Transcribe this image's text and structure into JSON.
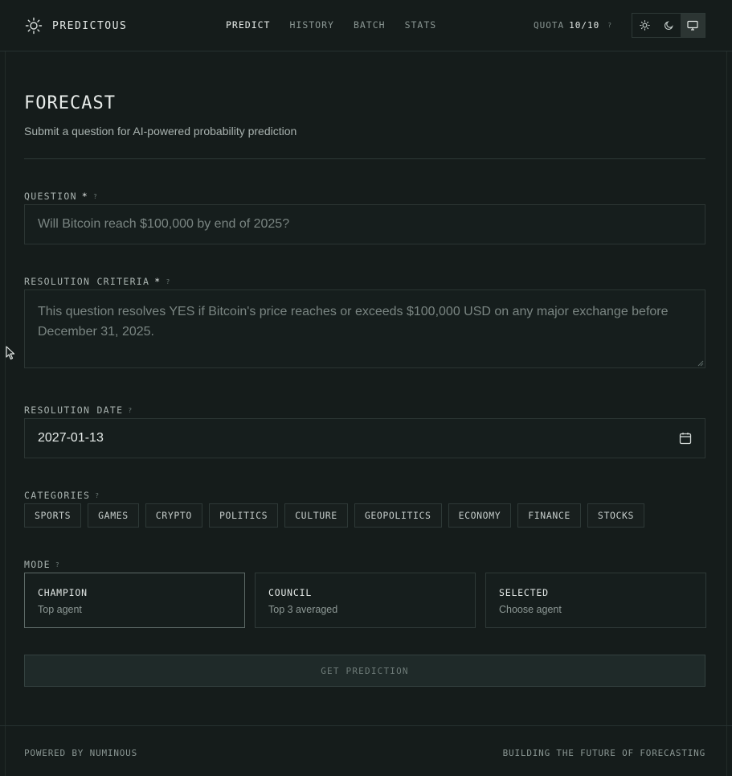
{
  "header": {
    "brand": "PREDICTOUS",
    "brand_icon": "sun-logo-icon",
    "nav": [
      {
        "label": "PREDICT",
        "active": true
      },
      {
        "label": "HISTORY",
        "active": false
      },
      {
        "label": "BATCH",
        "active": false
      },
      {
        "label": "STATS",
        "active": false
      }
    ],
    "quota_label": "QUOTA",
    "quota_value": "10/10",
    "quota_help": "?",
    "theme_options": [
      "sun-icon",
      "moon-icon",
      "monitor-icon"
    ],
    "theme_selected": "monitor-icon"
  },
  "page": {
    "title": "FORECAST",
    "subtitle": "Submit a question for AI-powered probability prediction"
  },
  "form": {
    "question": {
      "label": "QUESTION",
      "required": "*",
      "help": "?",
      "placeholder": "Will Bitcoin reach $100,000 by end of 2025?"
    },
    "criteria": {
      "label": "RESOLUTION CRITERIA",
      "required": "*",
      "help": "?",
      "placeholder": "This question resolves YES if Bitcoin's price reaches or exceeds $100,000 USD on any major exchange before December 31, 2025."
    },
    "date": {
      "label": "RESOLUTION DATE",
      "help": "?",
      "value": "2027-01-13"
    },
    "categories": {
      "label": "CATEGORIES",
      "help": "?",
      "items": [
        "SPORTS",
        "GAMES",
        "CRYPTO",
        "POLITICS",
        "CULTURE",
        "GEOPOLITICS",
        "ECONOMY",
        "FINANCE",
        "STOCKS"
      ]
    },
    "mode": {
      "label": "MODE",
      "help": "?",
      "options": [
        {
          "title": "CHAMPION",
          "desc": "Top agent",
          "selected": true
        },
        {
          "title": "COUNCIL",
          "desc": "Top 3 averaged",
          "selected": false
        },
        {
          "title": "SELECTED",
          "desc": "Choose agent",
          "selected": false
        }
      ]
    },
    "submit_label": "GET PREDICTION"
  },
  "footer": {
    "left": "POWERED BY NUMINOUS",
    "right": "BUILDING THE FUTURE OF FORECASTING"
  }
}
